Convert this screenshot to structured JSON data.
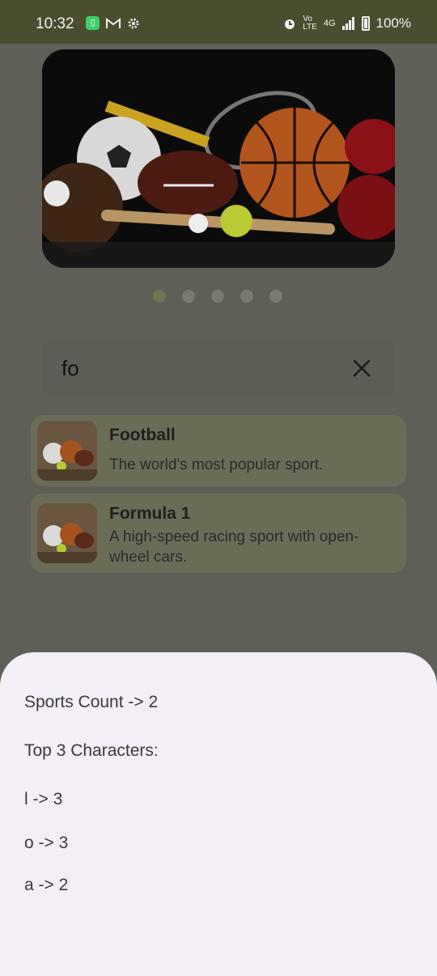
{
  "status_bar": {
    "time": "10:32",
    "battery": "100%",
    "network": "4G"
  },
  "carousel": {
    "image_icon": "sports-equipment-image",
    "page_count": 5,
    "active_index": 0
  },
  "search": {
    "value": "fo"
  },
  "results": [
    {
      "title": "Football",
      "description": "The world's most popular sport."
    },
    {
      "title": "Formula 1",
      "description": "A high-speed racing sport with open-wheel cars."
    }
  ],
  "sheet": {
    "count_line": "Sports Count -> 2",
    "top_heading": "Top 3 Characters:",
    "chars": [
      "l -> 3",
      "o -> 3",
      "a -> 2"
    ]
  },
  "colors": {
    "status_bar": "#4a4d2e",
    "scrim": "#5f5f58",
    "sheet": "#f4eff6",
    "card": "#6b6c58",
    "active_dot": "#6f7650"
  }
}
